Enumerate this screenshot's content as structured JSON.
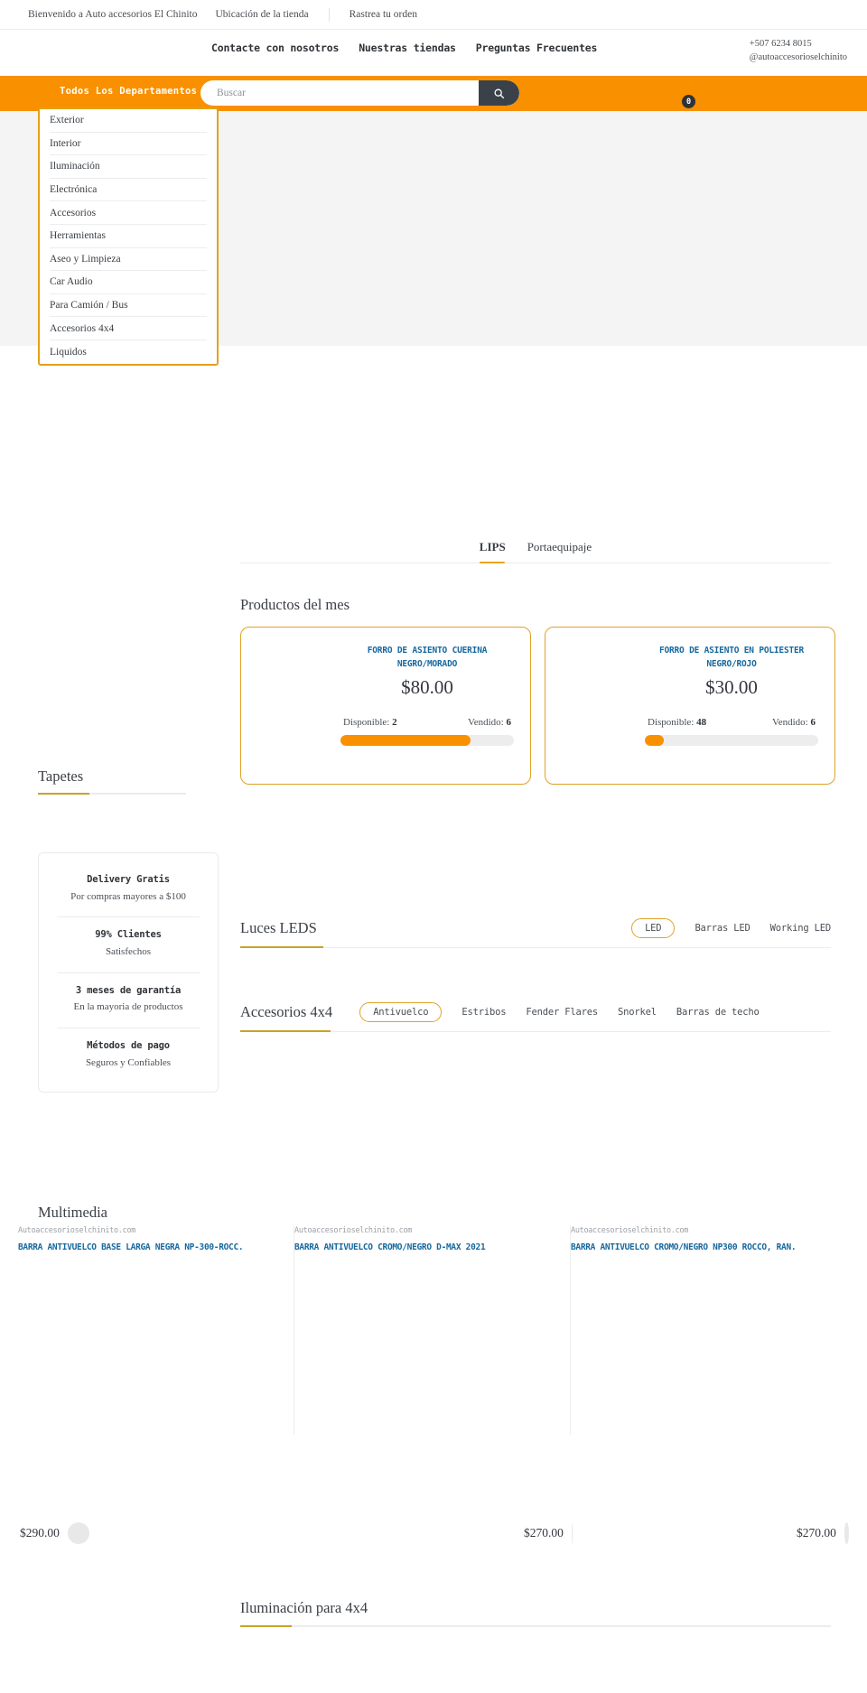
{
  "topbar": {
    "welcome": "Bienvenido a Auto accesorios El Chinito",
    "store_location": "Ubicación de la tienda",
    "track_order": "Rastrea tu orden"
  },
  "header": {
    "nav": [
      {
        "label": "Contacte con nosotros"
      },
      {
        "label": "Nuestras tiendas"
      },
      {
        "label": "Preguntas Frecuentes"
      }
    ],
    "phone": "+507 6234 8015",
    "social": "@autoaccesorioselchinito"
  },
  "search": {
    "departments_label": "Todos Los Departamentos",
    "placeholder": "Buscar",
    "value": "",
    "icon": "search-icon",
    "cart_count": "0",
    "accent_color": "#f99000"
  },
  "departments": {
    "items": [
      {
        "label": "Exterior"
      },
      {
        "label": "Interior"
      },
      {
        "label": "Iluminación"
      },
      {
        "label": "Electrónica"
      },
      {
        "label": "Accesorios"
      },
      {
        "label": "Herramientas"
      },
      {
        "label": "Aseo y Limpieza"
      },
      {
        "label": "Car Audio"
      },
      {
        "label": "Para Camión / Bus"
      },
      {
        "label": "Accesorios 4x4"
      },
      {
        "label": "Liquidos"
      }
    ]
  },
  "tabs": [
    {
      "label": "LIPS",
      "active": true
    },
    {
      "label": "Portaequipaje",
      "active": false
    }
  ],
  "productos_mes": {
    "title": "Productos del mes",
    "cards": [
      {
        "name": "FORRO DE ASIENTO CUERINA NEGRO/MORADO",
        "price": "$80.00",
        "available_label": "Disponible:",
        "available_value": "2",
        "sold_label": "Vendido:",
        "sold_value": "6",
        "progress_pct": 75
      },
      {
        "name": "FORRO DE ASIENTO EN POLIESTER NEGRO/ROJO",
        "price": "$30.00",
        "available_label": "Disponible:",
        "available_value": "48",
        "sold_label": "Vendido:",
        "sold_value": "6",
        "progress_pct": 11
      }
    ]
  },
  "tapetes": {
    "title": "Tapetes"
  },
  "info_card": {
    "blocks": [
      {
        "title": "Delivery Gratis",
        "sub": "Por compras mayores a $100"
      },
      {
        "title": "99% Clientes",
        "sub": "Satisfechos"
      },
      {
        "title": "3 meses de garantía",
        "sub": "En la mayoria de productos"
      },
      {
        "title": "Métodos de pago",
        "sub": "Seguros y Confiables"
      }
    ]
  },
  "luces_leds": {
    "title": "Luces LEDS",
    "filters": [
      {
        "label": "LED",
        "active": true
      },
      {
        "label": "Barras LED",
        "active": false
      },
      {
        "label": "Working LED",
        "active": false
      }
    ]
  },
  "accesorios_4x4": {
    "title": "Accesorios 4x4",
    "filters": [
      {
        "label": "Antivuelco",
        "active": true
      },
      {
        "label": "Estribos",
        "active": false
      },
      {
        "label": "Fender Flares",
        "active": false
      },
      {
        "label": "Snorkel",
        "active": false
      },
      {
        "label": "Barras de techo",
        "active": false
      }
    ]
  },
  "multimedia": {
    "title": "Multimedia",
    "items": [
      {
        "site": "Autoaccesorioselchinito.com",
        "title": "BARRA ANTIVUELCO BASE LARGA NEGRA NP-300-ROCC.",
        "price": "$290.00"
      },
      {
        "site": "Autoaccesorioselchinito.com",
        "title": "BARRA ANTIVUELCO CROMO/NEGRO D-MAX 2021",
        "price": "$270.00"
      },
      {
        "site": "Autoaccesorioselchinito.com",
        "title": "BARRA ANTIVUELCO CROMO/NEGRO NP300 ROCCO, RAN.",
        "price": "$270.00"
      }
    ]
  },
  "iluminacion_4x4": {
    "title": "Iluminación para 4x4"
  }
}
